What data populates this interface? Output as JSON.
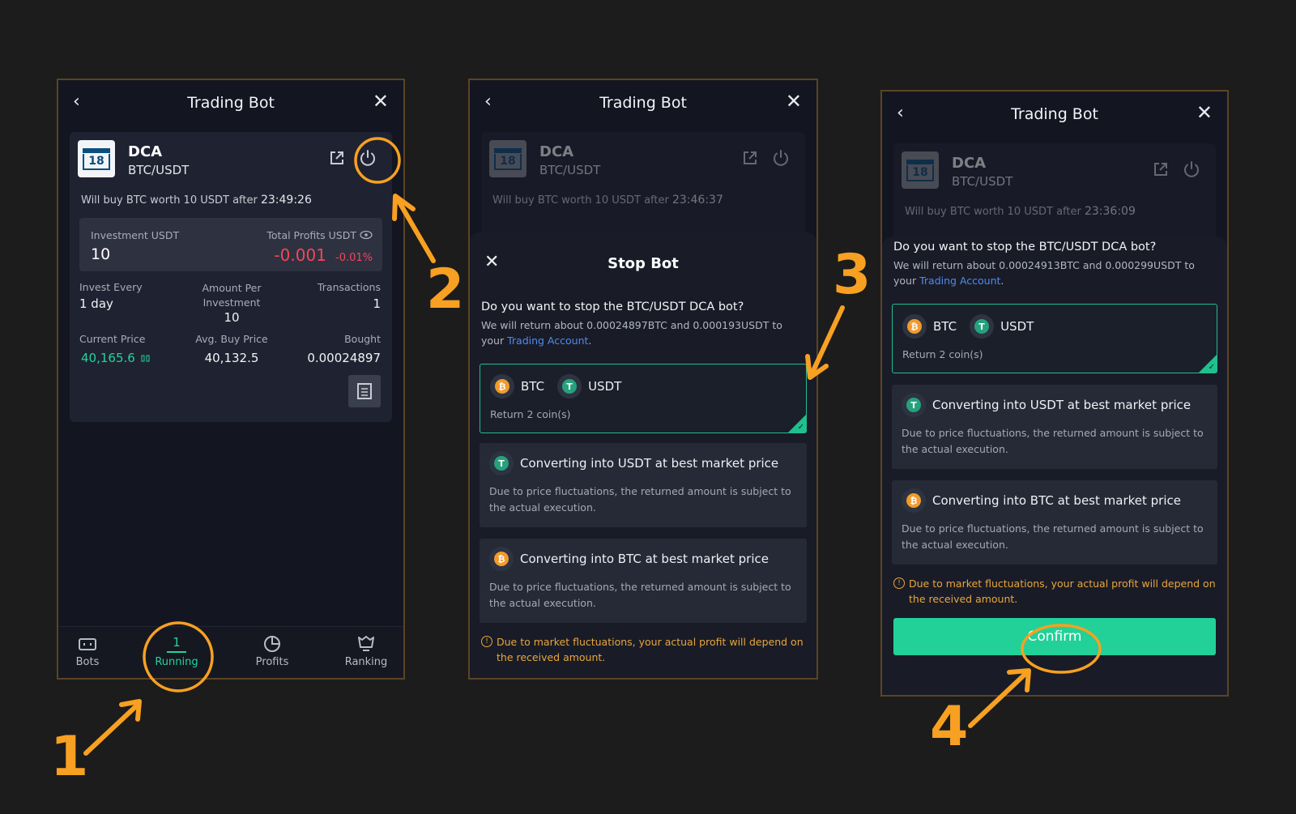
{
  "panel1": {
    "header": {
      "title": "Trading Bot",
      "back_icon": "‹",
      "close_icon": "✕"
    },
    "bot": {
      "calendar_number": "18",
      "name": "DCA",
      "pair": "BTC/USDT"
    },
    "will_buy": {
      "text": "Will buy BTC worth 10 USDT after",
      "time": "23:49:26"
    },
    "investment": {
      "label": "Investment USDT",
      "value": "10"
    },
    "profits": {
      "label": "Total Profits USDT",
      "value": "-0.001",
      "percent": "-0.01%"
    },
    "stats": {
      "invest_every_label": "Invest Every",
      "invest_every_value": "1 day",
      "amount_label": "Amount Per Investment",
      "amount_value": "10",
      "transactions_label": "Transactions",
      "transactions_value": "1",
      "current_price_label": "Current Price",
      "current_price_value": "40,165.6",
      "avg_buy_label": "Avg. Buy Price",
      "avg_buy_value": "40,132.5",
      "bought_label": "Bought",
      "bought_value": "0.00024897"
    },
    "nav": {
      "bots": "Bots",
      "running_count": "1",
      "running": "Running",
      "profits": "Profits",
      "ranking": "Ranking"
    }
  },
  "panel2": {
    "header": {
      "title": "Trading Bot"
    },
    "bot": {
      "calendar_number": "18",
      "name": "DCA",
      "pair": "BTC/USDT"
    },
    "will_buy": {
      "text": "Will buy BTC worth 10 USDT after",
      "time": "23:46:37"
    },
    "sheet": {
      "title": "Stop Bot",
      "question": "Do you want to stop the BTC/USDT DCA bot?",
      "sub_prefix": "We will return about 0.00024897BTC and 0.000193USDT to your",
      "link": "Trading Account",
      "sub_suffix": ".",
      "option1": {
        "coin1": "BTC",
        "coin2": "USDT",
        "desc": "Return 2 coin(s)"
      },
      "option2": {
        "title": "Converting into USDT at best market price",
        "desc": "Due to price fluctuations, the returned amount is subject to the actual execution."
      },
      "option3": {
        "title": "Converting into BTC at best market price",
        "desc": "Due to price fluctuations, the returned amount is subject to the actual execution."
      },
      "warning": "Due to market fluctuations, your actual profit will depend on the received amount."
    }
  },
  "panel3": {
    "header": {
      "title": "Trading Bot"
    },
    "bot": {
      "calendar_number": "18",
      "name": "DCA",
      "pair": "BTC/USDT"
    },
    "will_buy": {
      "text": "Will buy BTC worth 10 USDT after",
      "time": "23:36:09"
    },
    "sheet": {
      "question": "Do you want to stop the BTC/USDT DCA bot?",
      "sub_prefix": "We will return about 0.00024913BTC and 0.000299USDT to your",
      "link": "Trading Account",
      "sub_suffix": ".",
      "option1": {
        "coin1": "BTC",
        "coin2": "USDT",
        "desc": "Return 2 coin(s)"
      },
      "option2": {
        "title": "Converting into USDT at best market price",
        "desc": "Due to price fluctuations, the returned amount is subject to the actual execution."
      },
      "option3": {
        "title": "Converting into BTC at best market price",
        "desc": "Due to price fluctuations, the returned amount is subject to the actual execution."
      },
      "warning": "Due to market fluctuations, your actual profit will depend on the received amount.",
      "confirm": "Confirm"
    }
  },
  "annotations": {
    "step1": "1",
    "step2": "2",
    "step3": "3",
    "step4": "4",
    "color": "#f7a021"
  },
  "colors": {
    "accent_green": "#22d197",
    "loss_red": "#f0475a",
    "link_blue": "#4c8cf0",
    "warning_orange": "#e7a63c"
  }
}
